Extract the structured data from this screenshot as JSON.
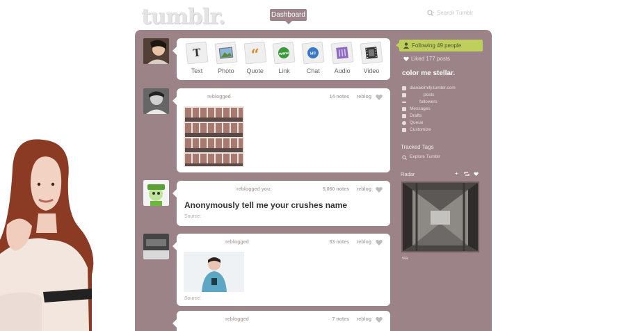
{
  "header": {
    "logo": "tumblr.",
    "dashboard_label": "Dashboard",
    "search_placeholder": "Search Tumblr"
  },
  "post_types": [
    {
      "label": "Text",
      "icon": "text-type-icon"
    },
    {
      "label": "Photo",
      "icon": "photo-type-icon"
    },
    {
      "label": "Quote",
      "icon": "quote-type-icon"
    },
    {
      "label": "Link",
      "icon": "link-type-icon"
    },
    {
      "label": "Chat",
      "icon": "chat-type-icon"
    },
    {
      "label": "Audio",
      "icon": "audio-type-icon"
    },
    {
      "label": "Video",
      "icon": "video-type-icon"
    }
  ],
  "posts": [
    {
      "action": "reblogged",
      "notes": "14 notes",
      "reblog": "reblog"
    },
    {
      "action": "reblogged you:",
      "notes": "5,060 notes",
      "reblog": "reblog",
      "title": "Anonymously tell me your crushes name",
      "source": "Source:"
    },
    {
      "action": "reblogged",
      "notes": "53 notes",
      "reblog": "reblog",
      "source": "Source:"
    },
    {
      "action": "reblogged",
      "notes": "7 notes",
      "reblog": "reblog"
    }
  ],
  "sidebar": {
    "following": "Following 49 people",
    "liked": "Liked 177 posts",
    "blog_name": "color me stellar.",
    "blog_url": "dianakimify.tumblr.com",
    "posts_label": "posts",
    "followers_label": "followers",
    "messages": "Messages",
    "drafts": "Drafts",
    "queue": "Queue",
    "customize": "Customize",
    "tracked_tags": "Tracked Tags",
    "explore": "Explore Tumblr",
    "radar": "Radar",
    "via": "via"
  },
  "colors": {
    "panel": "#9b8387",
    "accent_following": "#bfcf5b",
    "dashboard_button": "#9c8488"
  }
}
